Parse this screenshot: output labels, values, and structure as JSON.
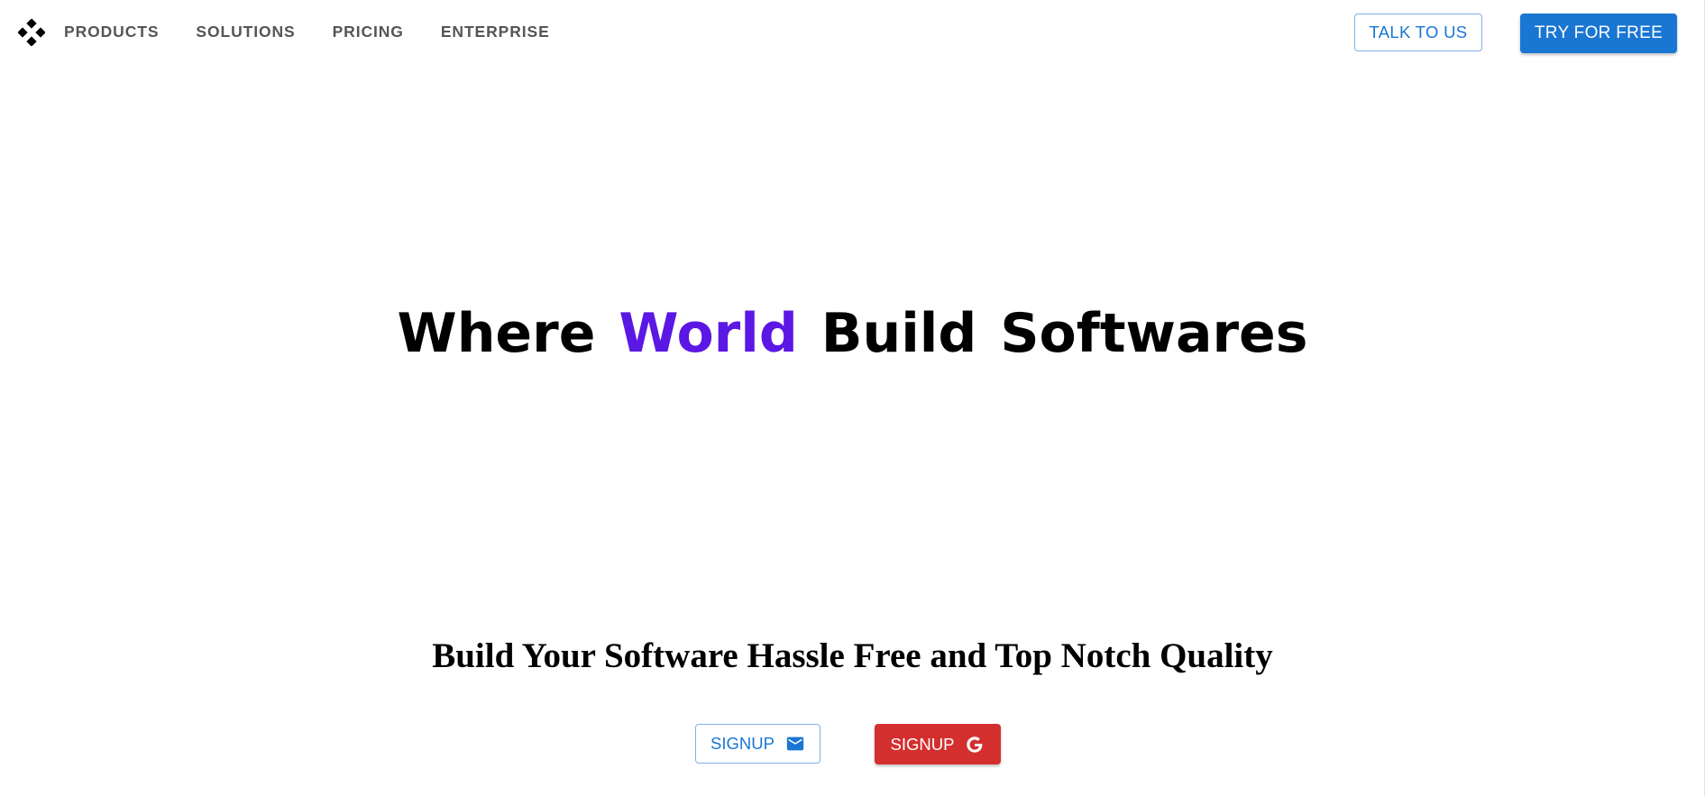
{
  "header": {
    "logo_icon": "diamond-grid-logo-icon",
    "nav": [
      {
        "label": "PRODUCTS"
      },
      {
        "label": "SOLUTIONS"
      },
      {
        "label": "PRICING"
      },
      {
        "label": "ENTERPRISE"
      }
    ],
    "talk_label": "TALK TO US",
    "try_label": "TRY FOR FREE"
  },
  "hero": {
    "title_words": [
      "Where",
      "World",
      "Build",
      "Softwares"
    ],
    "accent_word_color": "#5b17e4",
    "subtitle": "Build Your Software Hassle Free and Top Notch Quality"
  },
  "signup": {
    "email_label": "SIGNUP",
    "email_icon": "mail-icon",
    "google_label": "SIGNUP",
    "google_icon": "google-icon"
  },
  "colors": {
    "primary": "#1976d2",
    "danger": "#d32f2f",
    "nav_text": "#555555"
  }
}
